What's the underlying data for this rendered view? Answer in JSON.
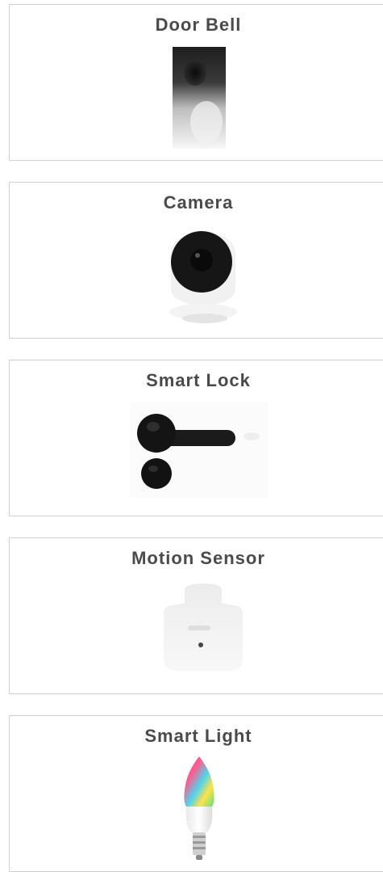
{
  "devices": [
    {
      "name": "Door Bell",
      "icon": "doorbell-icon"
    },
    {
      "name": "Camera",
      "icon": "camera-icon"
    },
    {
      "name": "Smart Lock",
      "icon": "smart-lock-icon"
    },
    {
      "name": "Motion Sensor",
      "icon": "motion-sensor-icon"
    },
    {
      "name": "Smart Light",
      "icon": "smart-light-icon"
    }
  ],
  "colors": {
    "card_border": "#d0d0d0",
    "title_text": "#4a4a4a",
    "background": "#ffffff"
  }
}
